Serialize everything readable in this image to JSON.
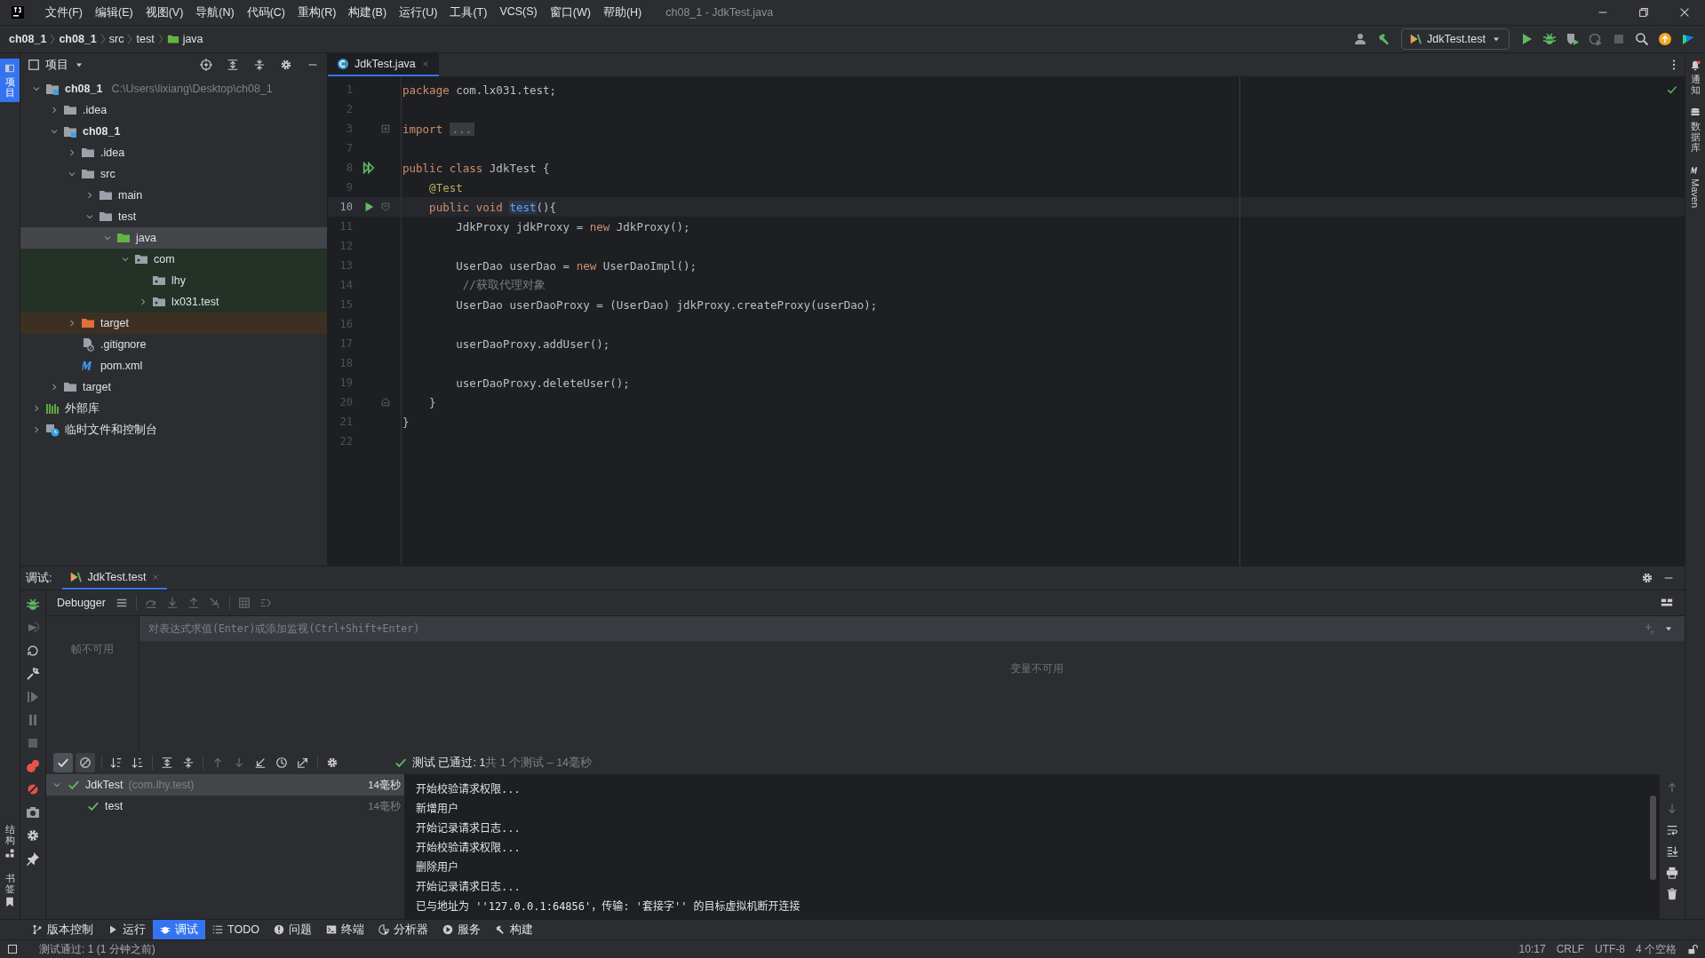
{
  "window": {
    "title": "ch08_1 - JdkTest.java"
  },
  "menu": [
    "文件(F)",
    "编辑(E)",
    "视图(V)",
    "导航(N)",
    "代码(C)",
    "重构(R)",
    "构建(B)",
    "运行(U)",
    "工具(T)",
    "VCS(S)",
    "窗口(W)",
    "帮助(H)"
  ],
  "breadcrumbs": [
    {
      "label": "ch08_1",
      "kind": "module"
    },
    {
      "label": "ch08_1",
      "kind": "module"
    },
    {
      "label": "src",
      "kind": "dir"
    },
    {
      "label": "test",
      "kind": "dir"
    },
    {
      "label": "java",
      "kind": "test-root"
    }
  ],
  "run_config": "JdkTest.test",
  "left_stripe": {
    "top": [
      {
        "label": "项目",
        "selected": true
      }
    ],
    "bottom": [
      {
        "label": "结构",
        "selected": false
      },
      {
        "label": "书签",
        "selected": false
      }
    ]
  },
  "right_stripe": [
    {
      "label": "通知",
      "kind": "cjk"
    },
    {
      "label": "数据库",
      "kind": "cjk"
    },
    {
      "label": "Maven",
      "kind": "latin"
    }
  ],
  "project": {
    "title": "项目",
    "tree": [
      {
        "label": "ch08_1",
        "hint": "C:\\Users\\lixiang\\Desktop\\ch08_1",
        "kind": "module",
        "expanded": true,
        "selected": false,
        "children": [
          {
            "label": ".idea",
            "kind": "folder",
            "expanded": false,
            "selected": false
          },
          {
            "label": "ch08_1",
            "kind": "module",
            "expanded": true,
            "selected": false,
            "children": [
              {
                "label": ".idea",
                "kind": "folder",
                "expanded": false,
                "selected": false
              },
              {
                "label": "src",
                "kind": "folder",
                "expanded": true,
                "selected": false,
                "children": [
                  {
                    "label": "main",
                    "kind": "folder",
                    "expanded": false,
                    "selected": false
                  },
                  {
                    "label": "test",
                    "kind": "folder",
                    "expanded": true,
                    "selected": false,
                    "children": [
                      {
                        "label": "java",
                        "kind": "test-root",
                        "expanded": true,
                        "selected": true,
                        "children": [
                          {
                            "label": "com",
                            "kind": "test-package",
                            "expanded": true,
                            "selected": false,
                            "children": [
                              {
                                "label": "lhy",
                                "kind": "test-package",
                                "selected": false
                              },
                              {
                                "label": "lx031.test",
                                "kind": "test-package",
                                "expanded": false,
                                "selected": false
                              }
                            ]
                          }
                        ]
                      }
                    ]
                  }
                ]
              },
              {
                "label": "target",
                "kind": "excluded",
                "expanded": false,
                "selected": false
              },
              {
                "label": ".gitignore",
                "kind": "ignore-file",
                "selected": false
              },
              {
                "label": "pom.xml",
                "kind": "maven",
                "selected": false
              }
            ]
          },
          {
            "label": "target",
            "kind": "folder",
            "expanded": false,
            "selected": false
          }
        ]
      },
      {
        "label": "外部库",
        "kind": "library",
        "expanded": false,
        "selected": false
      },
      {
        "label": "临时文件和控制台",
        "kind": "scratch",
        "expanded": false,
        "selected": false
      }
    ]
  },
  "editor": {
    "tabs": [
      {
        "label": "JdkTest.java",
        "selected": true
      }
    ],
    "lines": [
      {
        "number": "1",
        "current": false,
        "segments": [
          {
            "kind": "kw",
            "text": "package"
          },
          {
            "kind": "plain",
            "text": " com.lx031.test;"
          }
        ]
      },
      {
        "number": "2",
        "current": false
      },
      {
        "number": "3",
        "current": false,
        "fold": {
          "kind": "plus"
        },
        "segments": [
          {
            "kind": "kw",
            "text": "import"
          },
          {
            "kind": "fold",
            "text": "..."
          }
        ]
      },
      {
        "number": "7",
        "current": false
      },
      {
        "number": "8",
        "current": false,
        "gutter": {
          "kind": "run-all"
        },
        "segments": [
          {
            "kind": "kw",
            "text": "public class"
          },
          {
            "kind": "plain",
            "text": " JdkTest {"
          }
        ]
      },
      {
        "number": "9",
        "current": false,
        "segments": [
          {
            "kind": "ann",
            "text": "    @Test"
          }
        ]
      },
      {
        "number": "10",
        "current": true,
        "gutter": {
          "kind": "run"
        },
        "fold": {
          "kind": "open"
        },
        "segments": [
          {
            "kind": "kw",
            "text": "    public void"
          },
          {
            "kind": "decl",
            "text": "test"
          },
          {
            "kind": "plain",
            "text": "(){"
          }
        ]
      },
      {
        "number": "11",
        "current": false,
        "segments": [
          {
            "kind": "plain",
            "text": "        JdkProxy jdkProxy = "
          },
          {
            "kind": "kw",
            "text": "new"
          },
          {
            "kind": "plain",
            "text": " JdkProxy();"
          }
        ]
      },
      {
        "number": "12",
        "current": false
      },
      {
        "number": "13",
        "current": false,
        "segments": [
          {
            "kind": "plain",
            "text": "        UserDao userDao = "
          },
          {
            "kind": "kw",
            "text": "new"
          },
          {
            "kind": "plain",
            "text": " UserDaoImpl();"
          }
        ]
      },
      {
        "number": "14",
        "current": false,
        "segments": [
          {
            "kind": "comment",
            "text": "         //获取代理对象"
          }
        ]
      },
      {
        "number": "15",
        "current": false,
        "segments": [
          {
            "kind": "plain",
            "text": "        UserDao userDaoProxy = (UserDao) jdkProxy.createProxy(userDao);"
          }
        ]
      },
      {
        "number": "16",
        "current": false
      },
      {
        "number": "17",
        "current": false,
        "segments": [
          {
            "kind": "plain",
            "text": "        userDaoProxy.addUser();"
          }
        ]
      },
      {
        "number": "18",
        "current": false
      },
      {
        "number": "19",
        "current": false,
        "segments": [
          {
            "kind": "plain",
            "text": "        userDaoProxy.deleteUser();"
          }
        ]
      },
      {
        "number": "20",
        "current": false,
        "fold": {
          "kind": "close"
        },
        "segments": [
          {
            "kind": "plain",
            "text": "    }"
          }
        ]
      },
      {
        "number": "21",
        "current": false,
        "segments": [
          {
            "kind": "plain",
            "text": "}"
          }
        ]
      },
      {
        "number": "22",
        "current": false
      }
    ]
  },
  "debug": {
    "label": "调试:",
    "tabs": [
      {
        "label": "JdkTest.test",
        "selected": true
      }
    ],
    "debugger_tab": "Debugger",
    "frames_empty": "帧不可用",
    "eval_placeholder": "对表达式求值(Enter)或添加监视(Ctrl+Shift+Enter)",
    "variables_empty": "变量不可用",
    "show_passed": true,
    "show_ignored": false,
    "test_status": "**测试 已通过: 1**共 1 个测试 – 14毫秒",
    "tests": [
      {
        "name": "JdkTest",
        "package": "(com.lhy.test)",
        "time": "14毫秒",
        "passed": true,
        "expanded": true,
        "selected": true,
        "children": [
          {
            "name": "test",
            "time": "14毫秒",
            "passed": true,
            "selected": false
          }
        ]
      }
    ],
    "console": [
      "开始校验请求权限...",
      "新增用户",
      "开始记录请求日志...",
      "开始校验请求权限...",
      "删除用户",
      "开始记录请求日志...",
      "已与地址为 ''127.0.0.1:64856'，传输: '套接字'' 的目标虚拟机断开连接"
    ]
  },
  "bottom_tabs": [
    {
      "label": "版本控制",
      "selected": false
    },
    {
      "label": "运行",
      "selected": false
    },
    {
      "label": "调试",
      "selected": true
    },
    {
      "label": "TODO",
      "selected": false
    },
    {
      "label": "问题",
      "selected": false
    },
    {
      "label": "终端",
      "selected": false
    },
    {
      "label": "分析器",
      "selected": false
    },
    {
      "label": "服务",
      "selected": false
    },
    {
      "label": "构建",
      "selected": false
    }
  ],
  "status_bar": {
    "message": "测试通过: 1 (1 分钟之前)",
    "items": [
      "10:17",
      "CRLF",
      "UTF-8",
      "4 个空格"
    ]
  }
}
